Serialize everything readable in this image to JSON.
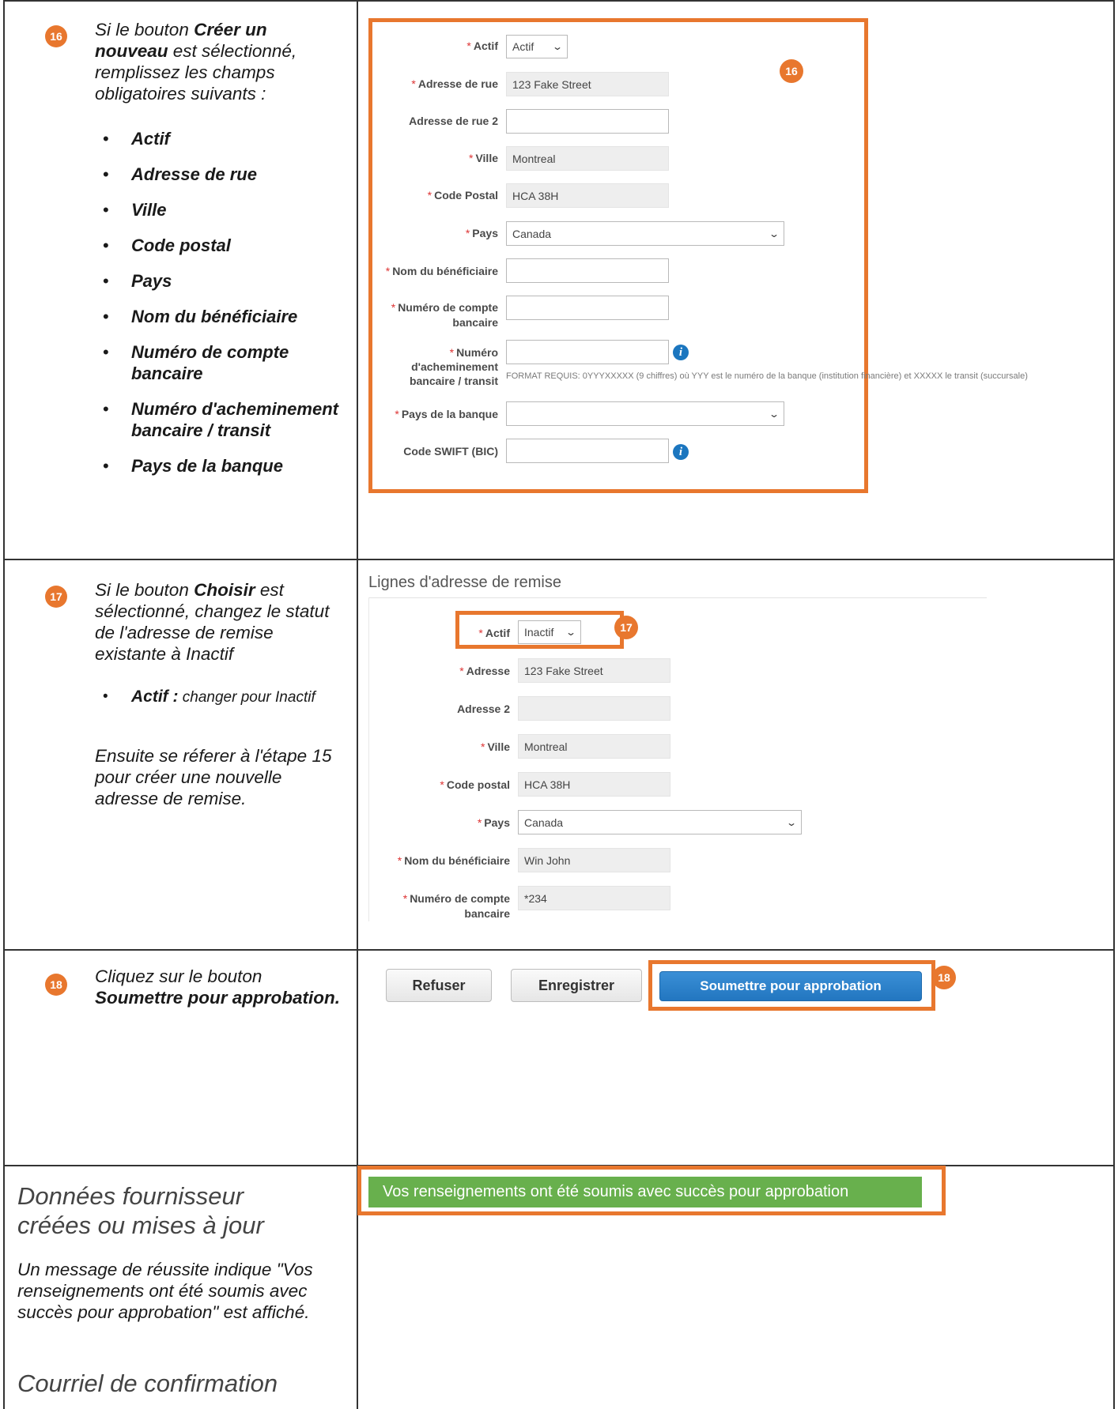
{
  "step16": {
    "badge": "16",
    "intro_pre": "Si le bouton ",
    "intro_bold": "Créer un nouveau",
    "intro_post": " est sélectionné, remplissez les champs obligatoires suivants :",
    "bullets": [
      "Actif",
      "Adresse de rue",
      "Ville",
      "Code postal",
      "Pays",
      "Nom du bénéficiaire",
      "Numéro de compte bancaire",
      "Numéro d'acheminement bancaire / transit",
      "Pays de la banque"
    ],
    "form": {
      "badge": "16",
      "actif_label": "Actif",
      "actif_value": "Actif",
      "street_label": "Adresse de rue",
      "street_value": "123 Fake Street",
      "street2_label": "Adresse de rue 2",
      "city_label": "Ville",
      "city_value": "Montreal",
      "postal_label": "Code Postal",
      "postal_value": "HCA 38H",
      "country_label": "Pays",
      "country_value": "Canada",
      "beneficiary_label": "Nom du bénéficiaire",
      "account_label_1": "Numéro de compte",
      "account_label_2": "bancaire",
      "routing_label_1": "Numéro",
      "routing_label_2": "d'acheminement",
      "routing_label_3": "bancaire / transit",
      "routing_hint": "FORMAT REQUIS: 0YYYXXXXX (9 chiffres) où YYY est le numéro de la banque (institution financière) et XXXXX le transit (succursale)",
      "bank_country_label": "Pays de la banque",
      "swift_label": "Code SWIFT (BIC)"
    }
  },
  "step17": {
    "badge": "17",
    "intro_pre": "Si le bouton ",
    "intro_bold": "Choisir",
    "intro_post": " est sélectionné, changez le statut de l'adresse de remise existante à Inactif",
    "bullet_bold": "Actif :",
    "bullet_rest": " changer pour Inactif",
    "followup": "Ensuite se réferer à l'étape 15 pour créer  une nouvelle adresse de remise.",
    "form": {
      "section_title": "Lignes d'adresse de remise",
      "badge": "17",
      "actif_label": "Actif",
      "actif_value": "Inactif",
      "address_label": "Adresse",
      "address_value": "123 Fake Street",
      "address2_label": "Adresse 2",
      "city_label": "Ville",
      "city_value": "Montreal",
      "postal_label": "Code postal",
      "postal_value": "HCA 38H",
      "country_label": "Pays",
      "country_value": "Canada",
      "beneficiary_label": "Nom du bénéficiaire",
      "beneficiary_value": "Win John",
      "account_label_1": "Numéro de compte",
      "account_label_2": "bancaire",
      "account_value": "*234"
    }
  },
  "step18": {
    "badge": "18",
    "intro_pre": "Cliquez sur le bouton ",
    "intro_bold": "Soumettre pour approbation.",
    "buttons": {
      "refuse": "Refuser",
      "save": "Enregistrer",
      "submit": "Soumettre pour approbation"
    },
    "screen_badge": "18"
  },
  "final": {
    "heading": "Données fournisseur créées ou mises à jour",
    "description": "Un message de réussite indique \"Vos renseignements ont été soumis avec succès pour approbation\" est affiché.",
    "email_heading": "Courriel de confirmation",
    "success_message": "Vos renseignements ont été soumis avec succès pour approbation"
  },
  "colors": {
    "accent_orange": "#e8772e",
    "primary_blue": "#2276c0",
    "success_green": "#68b04d",
    "required_red": "#d33"
  }
}
